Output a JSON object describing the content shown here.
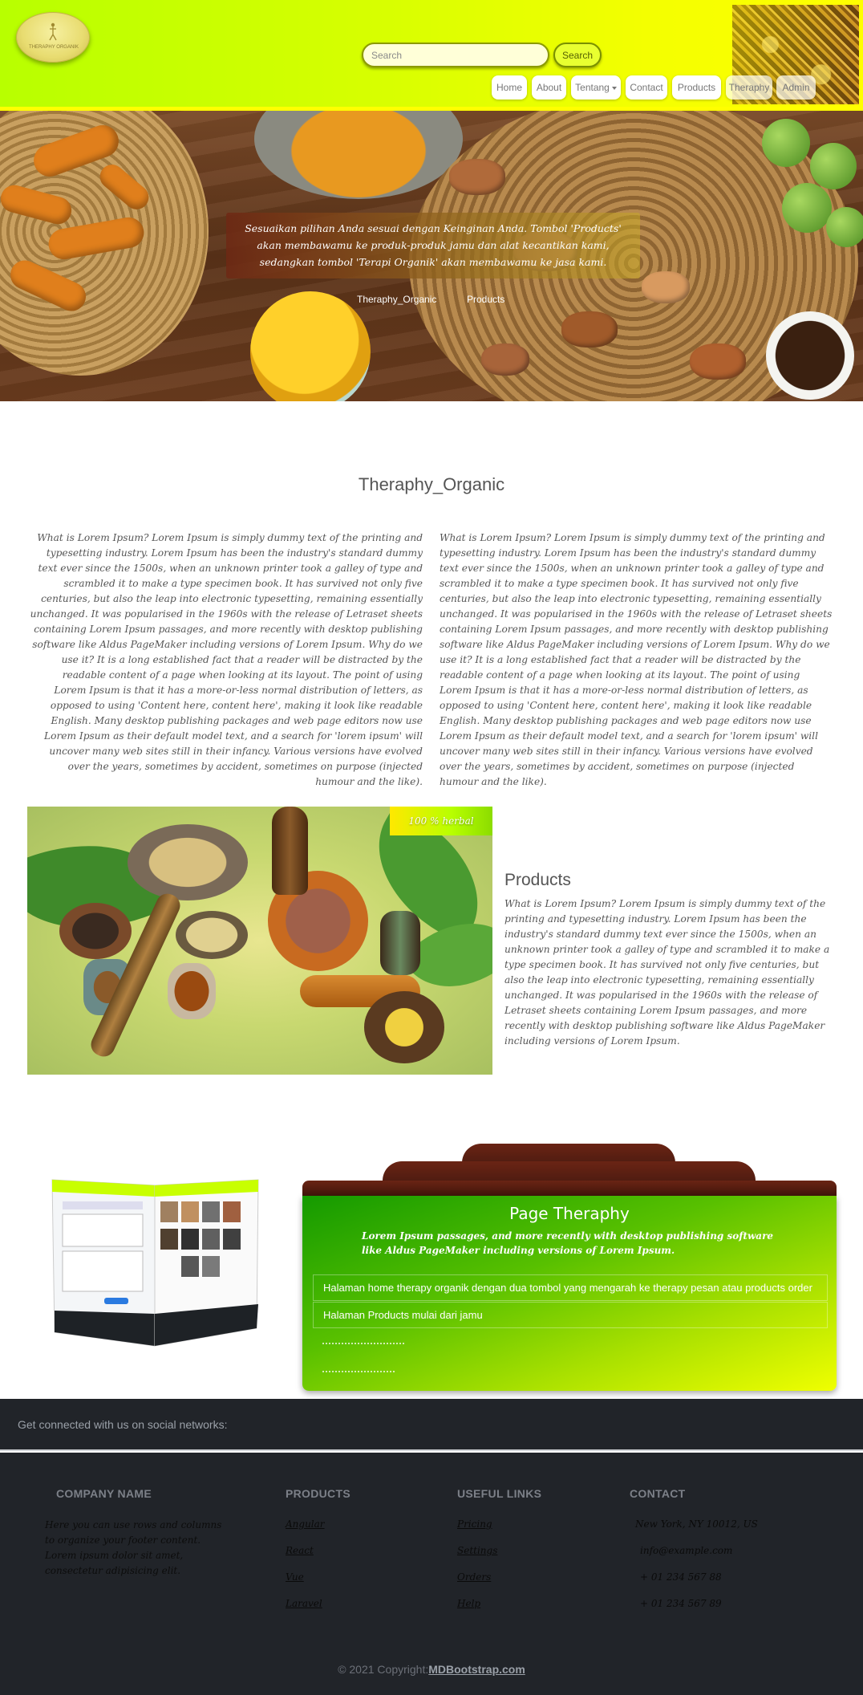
{
  "header": {
    "logo_text": "THERAPHY ORGANIK",
    "search": {
      "placeholder": "Search",
      "button_label": "Search"
    },
    "nav": [
      "Home",
      "About",
      "Tentang",
      "Contact",
      "Products",
      "Theraphy",
      "Admin"
    ]
  },
  "hero": {
    "caption": "Sesuaikan pilihan Anda sesuai dengan Keinginan Anda. Tombol 'Products' akan membawamu ke produk-produk jamu dan alat kecantikan kami, sedangkan tombol 'Terapi Organik' akan membawamu ke jasa kami.",
    "link_left": "Theraphy_Organic",
    "link_right": "Products"
  },
  "about": {
    "title": "Theraphy_Organic",
    "col_left": "What is Lorem Ipsum? Lorem Ipsum is simply dummy text of the printing and typesetting industry. Lorem Ipsum has been the industry's standard dummy text ever since the 1500s, when an unknown printer took a galley of type and scrambled it to make a type specimen book. It has survived not only five centuries, but also the leap into electronic typesetting, remaining essentially unchanged. It was popularised in the 1960s with the release of Letraset sheets containing Lorem Ipsum passages, and more recently with desktop publishing software like Aldus PageMaker including versions of Lorem Ipsum. Why do we use it? It is a long established fact that a reader will be distracted by the readable content of a page when looking at its layout. The point of using Lorem Ipsum is that it has a more-or-less normal distribution of letters, as opposed to using 'Content here, content here', making it look like readable English. Many desktop publishing packages and web page editors now use Lorem Ipsum as their default model text, and a search for 'lorem ipsum' will uncover many web sites still in their infancy. Various versions have evolved over the years, sometimes by accident, sometimes on purpose (injected humour and the like).",
    "col_right": "What is Lorem Ipsum? Lorem Ipsum is simply dummy text of the printing and typesetting industry. Lorem Ipsum has been the industry's standard dummy text ever since the 1500s, when an unknown printer took a galley of type and scrambled it to make a type specimen book. It has survived not only five centuries, but also the leap into electronic typesetting, remaining essentially unchanged. It was popularised in the 1960s with the release of Letraset sheets containing Lorem Ipsum passages, and more recently with desktop publishing software like Aldus PageMaker including versions of Lorem Ipsum. Why do we use it? It is a long established fact that a reader will be distracted by the readable content of a page when looking at its layout. The point of using Lorem Ipsum is that it has a more-or-less normal distribution of letters, as opposed to using 'Content here, content here', making it look like readable English. Many desktop publishing packages and web page editors now use Lorem Ipsum as their default model text, and a search for 'lorem ipsum' will uncover many web sites still in their infancy. Various versions have evolved over the years, sometimes by accident, sometimes on purpose (injected humour and the like)."
  },
  "products": {
    "badge": "100 % herbal",
    "title": "Products",
    "text": "What is Lorem Ipsum? Lorem Ipsum is simply dummy text of the printing and typesetting industry. Lorem Ipsum has been the industry's standard dummy text ever since the 1500s, when an unknown printer took a galley of type and scrambled it to make a type specimen book. It has survived not only five centuries, but also the leap into electronic typesetting, remaining essentially unchanged. It was popularised in the 1960s with the release of Letraset sheets containing Lorem Ipsum passages, and more recently with desktop publishing software like Aldus PageMaker including versions of Lorem Ipsum."
  },
  "page_theraphy": {
    "title": "Page Theraphy",
    "subtitle": "Lorem Ipsum passages, and more recently with desktop publishing software like Aldus PageMaker including versions of Lorem Ipsum.",
    "items": [
      "Halaman home therapy organik dengan dua tombol yang mengarah ke therapy pesan atau products order",
      "Halaman Products mulai dari jamu"
    ]
  },
  "footer": {
    "social_text": "Get connected with us on social networks:",
    "company": {
      "heading": "COMPANY NAME",
      "description": "Here you can use rows and columns to organize your footer content. Lorem ipsum dolor sit amet, consectetur adipisicing elit."
    },
    "products": {
      "heading": "PRODUCTS",
      "links": [
        "Angular",
        "React",
        "Vue",
        "Laravel"
      ]
    },
    "useful": {
      "heading": "USEFUL LINKS",
      "links": [
        "Pricing",
        "Settings",
        "Orders",
        "Help"
      ]
    },
    "contact": {
      "heading": "CONTACT",
      "lines": [
        "New York, NY 10012, US",
        "info@example.com",
        "+ 01 234 567 88",
        "+ 01 234 567 89"
      ]
    },
    "copyright_prefix": "© 2021 Copyright:",
    "copyright_link": "MDBootstrap.com"
  },
  "colors": {
    "header_start": "#b8ff00",
    "header_end": "#ffff00",
    "panel_green": "#149a00",
    "panel_yellow": "#f0ff00",
    "footer_bg": "#212429",
    "tab_brown": "#5a1e10"
  }
}
